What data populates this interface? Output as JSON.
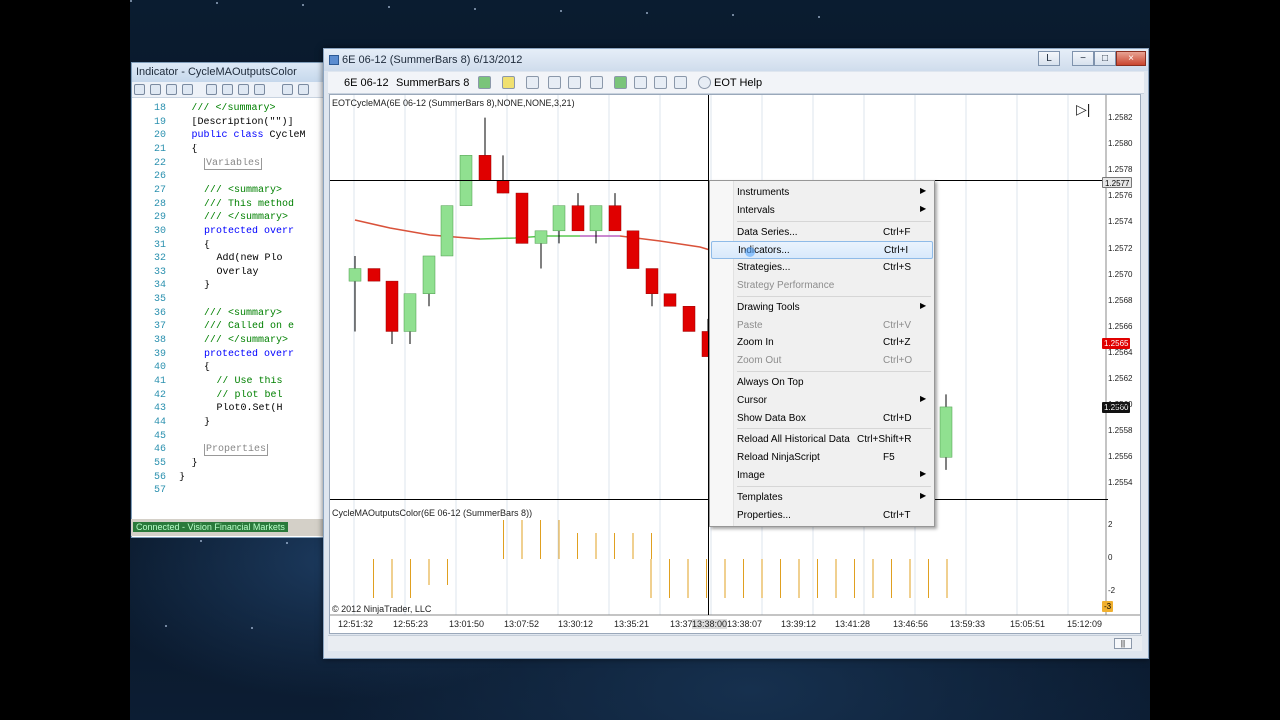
{
  "code_window": {
    "title": "Indicator - CycleMAOutputsColor",
    "status": "Connected - Vision Financial Markets",
    "lines": [
      {
        "n": "18",
        "t": "/// </summary>",
        "cls": "cm",
        "ind": 3
      },
      {
        "n": "19",
        "t": "[Description(\"\")]",
        "cls": "",
        "ind": 3
      },
      {
        "n": "20",
        "t": "public class CycleM",
        "cls": "kw2",
        "ind": 3
      },
      {
        "n": "21",
        "t": "{",
        "cls": "",
        "ind": 3
      },
      {
        "n": "22",
        "t": "Variables",
        "cls": "rg",
        "ind": 4
      },
      {
        "n": "26",
        "t": "",
        "cls": "",
        "ind": 3
      },
      {
        "n": "27",
        "t": "/// <summary>",
        "cls": "cm",
        "ind": 4
      },
      {
        "n": "28",
        "t": "/// This method",
        "cls": "cm",
        "ind": 4
      },
      {
        "n": "29",
        "t": "/// </summary>",
        "cls": "cm",
        "ind": 4
      },
      {
        "n": "30",
        "t": "protected overr",
        "cls": "kw",
        "ind": 4
      },
      {
        "n": "31",
        "t": "{",
        "cls": "",
        "ind": 4
      },
      {
        "n": "32",
        "t": "Add(new Plo",
        "cls": "",
        "ind": 5
      },
      {
        "n": "33",
        "t": "Overlay",
        "cls": "",
        "ind": 5
      },
      {
        "n": "34",
        "t": "}",
        "cls": "",
        "ind": 4
      },
      {
        "n": "35",
        "t": "",
        "cls": "",
        "ind": 3
      },
      {
        "n": "36",
        "t": "/// <summary>",
        "cls": "cm",
        "ind": 4
      },
      {
        "n": "37",
        "t": "/// Called on e",
        "cls": "cm",
        "ind": 4
      },
      {
        "n": "38",
        "t": "/// </summary>",
        "cls": "cm",
        "ind": 4
      },
      {
        "n": "39",
        "t": "protected overr",
        "cls": "kw",
        "ind": 4
      },
      {
        "n": "40",
        "t": "{",
        "cls": "",
        "ind": 4
      },
      {
        "n": "41",
        "t": "// Use this",
        "cls": "cm",
        "ind": 5
      },
      {
        "n": "42",
        "t": "// plot bel",
        "cls": "cm",
        "ind": 5
      },
      {
        "n": "43",
        "t": "Plot0.Set(H",
        "cls": "",
        "ind": 5
      },
      {
        "n": "44",
        "t": "}",
        "cls": "",
        "ind": 4
      },
      {
        "n": "45",
        "t": "",
        "cls": "",
        "ind": 3
      },
      {
        "n": "46",
        "t": "Properties",
        "cls": "rg",
        "ind": 4
      },
      {
        "n": "55",
        "t": "}",
        "cls": "",
        "ind": 3
      },
      {
        "n": "56",
        "t": "}",
        "cls": "",
        "ind": 2
      },
      {
        "n": "57",
        "t": "",
        "cls": "",
        "ind": 3
      }
    ]
  },
  "window": {
    "title": "6E 06-12 (SummerBars 8)  6/13/2012",
    "btn_l": "L",
    "btn_min": "−",
    "btn_max": "□",
    "btn_close": "×"
  },
  "toolbar": {
    "instrument": "6E 06-12",
    "bartype": "SummerBars 8",
    "help": "EOT Help"
  },
  "chart": {
    "panel1_label": "EOTCycleMA(6E 06-12 (SummerBars 8),NONE,NONE,3,21)",
    "panel2_label": "CycleMAOutputsColor(6E 06-12 (SummerBars 8))",
    "copyright": "© 2012 NinjaTrader, LLC",
    "price_labels": [
      "1.2582",
      "1.2580",
      "1.2578",
      "1.2576",
      "1.2574",
      "1.2572",
      "1.2570",
      "1.2568",
      "1.2566",
      "1.2564",
      "1.2562",
      "1.2560",
      "1.2558",
      "1.2556",
      "1.2554"
    ],
    "tag_crosshair": "1.2577",
    "tag_red": "1.2565",
    "tag_black": "1.2560",
    "osc_labels": [
      "2",
      "0",
      "-2"
    ],
    "osc_tag": "-3",
    "time_labels": [
      "12:51:32",
      "12:55:23",
      "13:01:50",
      "13:07:52",
      "13:30:12",
      "13:35:21",
      "13:37:",
      "13:38:00",
      "13:38:07",
      "13:39:12",
      "13:41:28",
      "13:46:56",
      "13:59:33",
      "15:05:51",
      "15:12:09"
    ],
    "colors": {
      "up": "#90e090",
      "down": "#e00000",
      "ma_red": "#d9523a",
      "ma_green": "#58c850",
      "ma_purple": "#b860c0",
      "osc": "#e0a020"
    }
  },
  "chart_data": {
    "type": "candlestick",
    "y_axis": "price",
    "ylim": [
      1.2553,
      1.2584
    ],
    "candles": [
      {
        "o": 1.257,
        "h": 1.2572,
        "l": 1.2566,
        "c": 1.2571
      },
      {
        "o": 1.2571,
        "h": 1.2571,
        "l": 1.257,
        "c": 1.257
      },
      {
        "o": 1.257,
        "h": 1.257,
        "l": 1.2565,
        "c": 1.2566
      },
      {
        "o": 1.2566,
        "h": 1.2569,
        "l": 1.2565,
        "c": 1.2569
      },
      {
        "o": 1.2569,
        "h": 1.2572,
        "l": 1.2568,
        "c": 1.2572
      },
      {
        "o": 1.2572,
        "h": 1.2576,
        "l": 1.2572,
        "c": 1.2576
      },
      {
        "o": 1.2576,
        "h": 1.258,
        "l": 1.2576,
        "c": 1.258
      },
      {
        "o": 1.258,
        "h": 1.2583,
        "l": 1.2578,
        "c": 1.2578
      },
      {
        "o": 1.2578,
        "h": 1.258,
        "l": 1.2577,
        "c": 1.2577
      },
      {
        "o": 1.2577,
        "h": 1.2577,
        "l": 1.2573,
        "c": 1.2573
      },
      {
        "o": 1.2573,
        "h": 1.2574,
        "l": 1.2571,
        "c": 1.2574
      },
      {
        "o": 1.2574,
        "h": 1.2576,
        "l": 1.2573,
        "c": 1.2576
      },
      {
        "o": 1.2576,
        "h": 1.2577,
        "l": 1.2574,
        "c": 1.2574
      },
      {
        "o": 1.2574,
        "h": 1.2576,
        "l": 1.2573,
        "c": 1.2576
      },
      {
        "o": 1.2576,
        "h": 1.2577,
        "l": 1.2574,
        "c": 1.2574
      },
      {
        "o": 1.2574,
        "h": 1.2574,
        "l": 1.2571,
        "c": 1.2571
      },
      {
        "o": 1.2571,
        "h": 1.2571,
        "l": 1.2568,
        "c": 1.2569
      },
      {
        "o": 1.2569,
        "h": 1.2569,
        "l": 1.2568,
        "c": 1.2568
      },
      {
        "o": 1.2568,
        "h": 1.2568,
        "l": 1.2566,
        "c": 1.2566
      },
      {
        "o": 1.2566,
        "h": 1.2567,
        "l": 1.2564,
        "c": 1.2564
      },
      {
        "o": 1.2556,
        "h": 1.2561,
        "l": 1.2555,
        "c": 1.256
      }
    ],
    "oscillator": [
      0,
      0,
      0,
      0,
      0,
      0,
      0,
      3,
      3,
      3,
      3,
      2,
      2,
      2,
      2,
      2,
      0,
      0,
      0,
      0,
      0,
      0,
      0,
      0,
      0,
      0,
      0,
      0,
      0,
      0,
      0,
      0,
      0
    ],
    "oscillator_neg": [
      0,
      -3,
      -3,
      -3,
      -2,
      -2,
      0,
      0,
      0,
      0,
      0,
      0,
      0,
      0,
      0,
      0,
      -3,
      -3,
      -3,
      -3,
      -3,
      -3,
      -3,
      -3,
      -3,
      -3,
      -3,
      -3,
      -3,
      -3,
      -3,
      -3,
      -3
    ]
  },
  "menu": {
    "items": [
      {
        "label": "Instruments",
        "sc": "",
        "sub": true,
        "dis": false,
        "hov": false
      },
      {
        "label": "Intervals",
        "sc": "",
        "sub": true,
        "dis": false,
        "hov": false
      },
      {
        "sep": true
      },
      {
        "label": "Data Series...",
        "sc": "Ctrl+F",
        "sub": false,
        "dis": false,
        "hov": false
      },
      {
        "label": "Indicators...",
        "sc": "Ctrl+I",
        "sub": false,
        "dis": false,
        "hov": true
      },
      {
        "label": "Strategies...",
        "sc": "Ctrl+S",
        "sub": false,
        "dis": false,
        "hov": false
      },
      {
        "label": "Strategy Performance",
        "sc": "",
        "sub": false,
        "dis": true,
        "hov": false
      },
      {
        "sep": true
      },
      {
        "label": "Drawing Tools",
        "sc": "",
        "sub": true,
        "dis": false,
        "hov": false
      },
      {
        "label": "Paste",
        "sc": "Ctrl+V",
        "sub": false,
        "dis": true,
        "hov": false
      },
      {
        "label": "Zoom In",
        "sc": "Ctrl+Z",
        "sub": false,
        "dis": false,
        "hov": false
      },
      {
        "label": "Zoom Out",
        "sc": "Ctrl+O",
        "sub": false,
        "dis": true,
        "hov": false
      },
      {
        "sep": true
      },
      {
        "label": "Always On Top",
        "sc": "",
        "sub": false,
        "dis": false,
        "hov": false
      },
      {
        "label": "Cursor",
        "sc": "",
        "sub": true,
        "dis": false,
        "hov": false
      },
      {
        "label": "Show Data Box",
        "sc": "Ctrl+D",
        "sub": false,
        "dis": false,
        "hov": false
      },
      {
        "sep": true
      },
      {
        "label": "Reload All Historical Data",
        "sc": "Ctrl+Shift+R",
        "sub": false,
        "dis": false,
        "hov": false
      },
      {
        "label": "Reload NinjaScript",
        "sc": "F5",
        "sub": false,
        "dis": false,
        "hov": false
      },
      {
        "label": "Image",
        "sc": "",
        "sub": true,
        "dis": false,
        "hov": false
      },
      {
        "sep": true
      },
      {
        "label": "Templates",
        "sc": "",
        "sub": true,
        "dis": false,
        "hov": false
      },
      {
        "label": "Properties...",
        "sc": "Ctrl+T",
        "sub": false,
        "dis": false,
        "hov": false
      }
    ]
  }
}
